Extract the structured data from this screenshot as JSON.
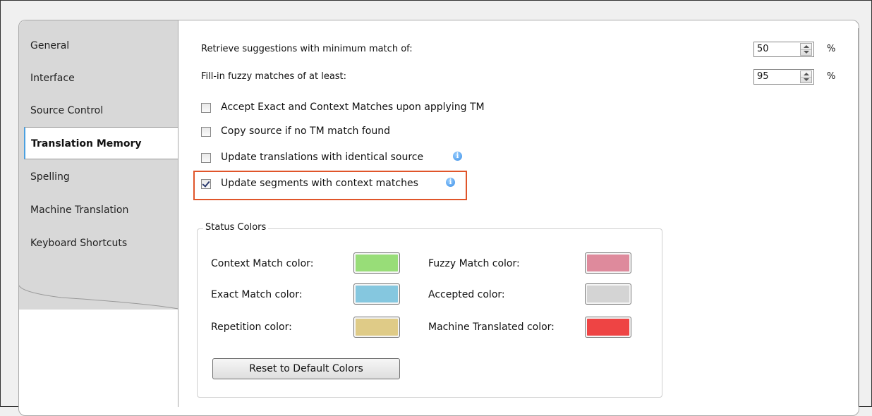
{
  "sidebar": {
    "items": [
      {
        "label": "General"
      },
      {
        "label": "Interface"
      },
      {
        "label": "Source Control"
      },
      {
        "label": "Translation Memory"
      },
      {
        "label": "Spelling"
      },
      {
        "label": "Machine Translation"
      },
      {
        "label": "Keyboard Shortcuts"
      }
    ],
    "active": "Translation Memory"
  },
  "settings": {
    "min_match": {
      "label": "Retrieve suggestions with minimum match of:",
      "value": "50",
      "unit": "%"
    },
    "fuzzy_fill": {
      "label": "Fill-in fuzzy matches of at least:",
      "value": "95",
      "unit": "%"
    },
    "checkboxes": [
      {
        "label": "Accept Exact and Context Matches upon applying TM",
        "checked": false,
        "info": false
      },
      {
        "label": "Copy source if no TM match found",
        "checked": false,
        "info": false
      },
      {
        "label": "Update translations with identical source",
        "checked": false,
        "info": true
      },
      {
        "label": "Update segments with context matches",
        "checked": true,
        "info": true
      }
    ]
  },
  "status_colors": {
    "title": "Status Colors",
    "left": [
      {
        "label": "Context Match color:",
        "color": "#98dd78"
      },
      {
        "label": "Exact Match color:",
        "color": "#85c7df"
      },
      {
        "label": "Repetition color:",
        "color": "#dfcb87"
      }
    ],
    "right": [
      {
        "label": "Fuzzy Match color:",
        "color": "#de8a9c"
      },
      {
        "label": "Accepted color:",
        "color": "#d4d4d4"
      },
      {
        "label": "Machine Translated color:",
        "color": "#ee4444"
      }
    ],
    "reset_label": "Reset to Default Colors"
  },
  "highlight_color": "#e0552a"
}
